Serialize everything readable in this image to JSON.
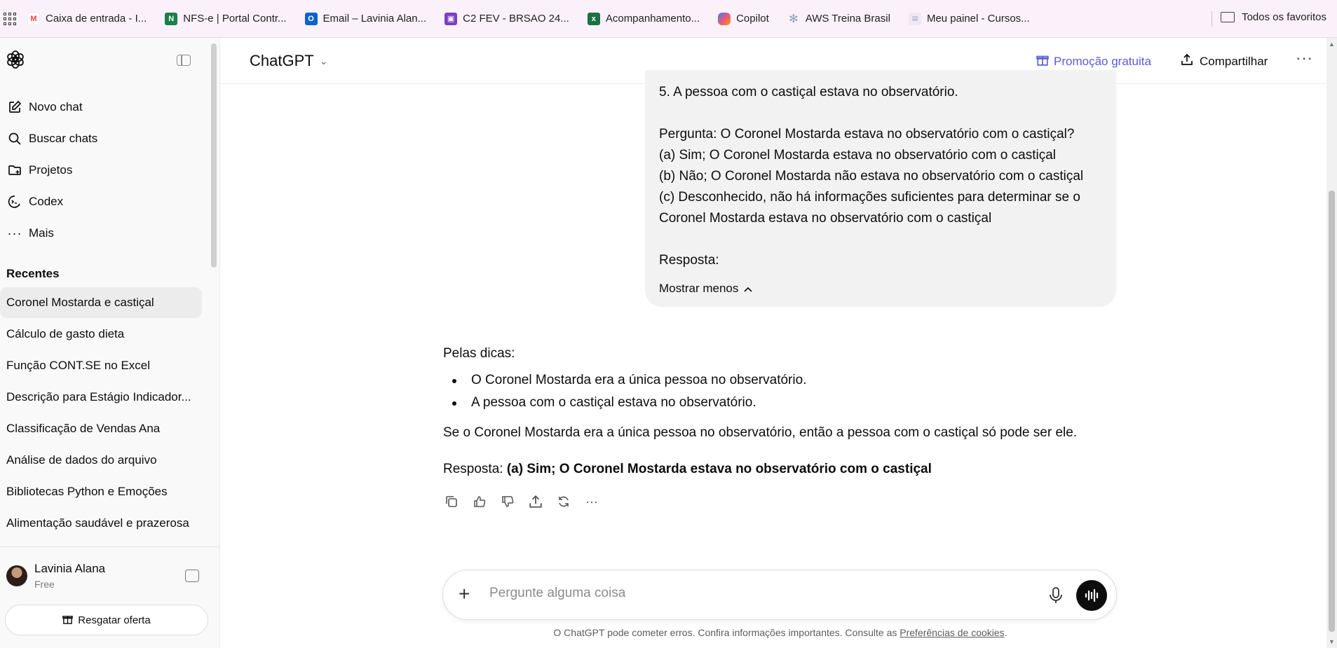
{
  "bookmarks": {
    "items": [
      {
        "label": "Caixa de entrada - I...",
        "icon": "gmail-icon",
        "color": "#ea4335"
      },
      {
        "label": "NFS-e | Portal Contr...",
        "icon": "nfse-icon",
        "color": "#1a7f4b"
      },
      {
        "label": "Email – Lavinia Alan...",
        "icon": "outlook-icon",
        "color": "#0a64c8"
      },
      {
        "label": "C2 FEV - BRSAO 24...",
        "icon": "forms-icon",
        "color": "#7b3fbf"
      },
      {
        "label": "Acompanhamento...",
        "icon": "excel-icon",
        "color": "#1d7044"
      },
      {
        "label": "Copilot",
        "icon": "copilot-icon",
        "color": "#e8567a"
      },
      {
        "label": "AWS Treina Brasil",
        "icon": "aws-icon",
        "color": "#8aa0b8"
      },
      {
        "label": "Meu painel - Cursos...",
        "icon": "course-icon",
        "color": "#a8a0c8"
      }
    ],
    "all_favorites": "Todos os favoritos"
  },
  "sidebar": {
    "nav": [
      {
        "label": "Novo chat",
        "icon": "edit-icon"
      },
      {
        "label": "Buscar chats",
        "icon": "search-icon"
      },
      {
        "label": "Projetos",
        "icon": "folder-icon"
      },
      {
        "label": "Codex",
        "icon": "codex-icon"
      },
      {
        "label": "Mais",
        "icon": "more-icon"
      }
    ],
    "recent_title": "Recentes",
    "chats": [
      "Coronel Mostarda e castiçal",
      "Cálculo de gasto dieta",
      "Função CONT.SE no Excel",
      "Descrição para Estágio Indicador...",
      "Classificação de Vendas Ana",
      "Análise de dados do arquivo",
      "Bibliotecas Python e Emoções",
      "Alimentação saudável e prazerosa"
    ],
    "user": {
      "name": "Lavinia Alana",
      "plan": "Free"
    },
    "offer_button": "Resgatar oferta"
  },
  "header": {
    "model": "ChatGPT",
    "promo": "Promoção gratuita",
    "share": "Compartilhar"
  },
  "user_message": {
    "lines": [
      "5. A pessoa com o castiçal estava no observatório.",
      "",
      "Pergunta: O Coronel Mostarda estava no observatório com o castiçal?",
      "(a) Sim; O Coronel Mostarda estava no observatório com o castiçal",
      "(b) Não; O Coronel Mostarda não estava no observatório com o castiçal",
      "(c) Desconhecido, não há informações suficientes para determinar se o",
      "Coronel Mostarda estava no observatório com o castiçal",
      "",
      "Resposta:"
    ],
    "show_less": "Mostrar menos"
  },
  "assistant": {
    "intro": "Pelas dicas:",
    "bullets": [
      "O Coronel Mostarda era a única pessoa no observatório.",
      "A pessoa com o castiçal estava no observatório."
    ],
    "reasoning": "Se o Coronel Mostarda era a única pessoa no observatório, então a pessoa com o castiçal só pode ser ele.",
    "answer_label": "Resposta: ",
    "answer_bold": "(a) Sim; O Coronel Mostarda estava no observatório com o castiçal"
  },
  "composer": {
    "placeholder": "Pergunte alguma coisa"
  },
  "disclaimer": {
    "text": "O ChatGPT pode cometer erros. Confira informações importantes. Consulte as ",
    "link": "Preferências de cookies",
    "end": "."
  },
  "colors": {
    "accent": "#5b5bd6",
    "bubble": "#f2f2f2",
    "sidebar": "#f9f9f9"
  }
}
